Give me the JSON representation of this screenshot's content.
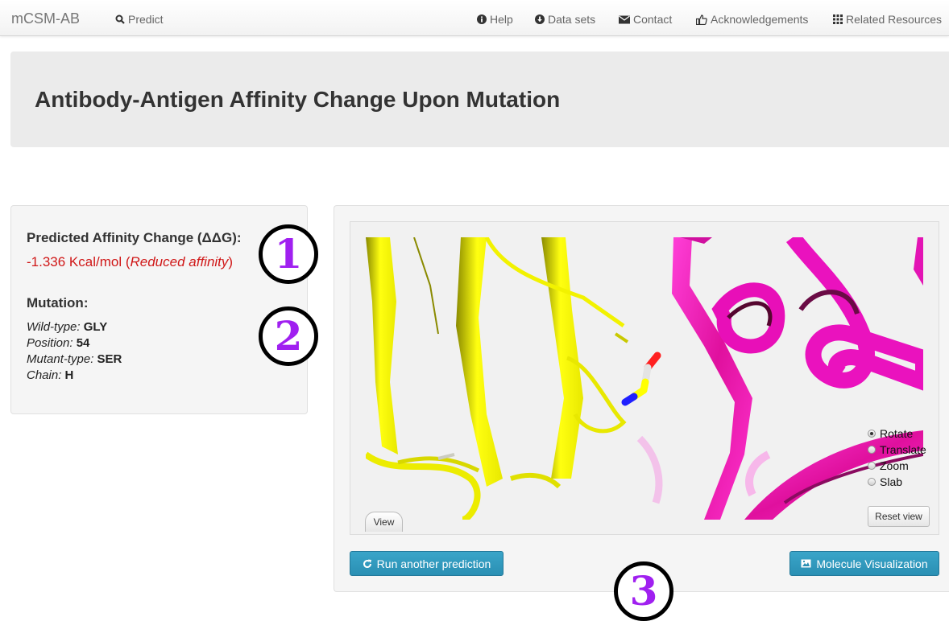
{
  "nav": {
    "brand": "mCSM-AB",
    "predict": "Predict",
    "help": "Help",
    "datasets": "Data sets",
    "contact": "Contact",
    "acknowledgements": "Acknowledgements",
    "related": "Related Resources"
  },
  "header": {
    "title": "Antibody-Antigen Affinity Change Upon Mutation"
  },
  "result": {
    "ddg_heading": "Predicted Affinity Change (ΔΔG):",
    "ddg_value": "-1.336 Kcal/mol (",
    "ddg_effect": "Reduced affinity",
    "ddg_close": ")",
    "mutation_heading": "Mutation:",
    "wildtype_label": "Wild-type:",
    "wildtype_value": "GLY",
    "position_label": "Position:",
    "position_value": "54",
    "mutant_label": "Mutant-type:",
    "mutant_value": "SER",
    "chain_label": "Chain:",
    "chain_value": "H"
  },
  "annotations": {
    "one": "1",
    "two": "2",
    "three": "3"
  },
  "viewer": {
    "modes": [
      "Rotate",
      "Translate",
      "Zoom",
      "Slab"
    ],
    "selected_mode": "Rotate",
    "view_button": "View",
    "reset_button": "Reset view"
  },
  "actions": {
    "run_again": "Run another prediction",
    "molecule_vis": "Molecule Visualization"
  },
  "colors": {
    "ddg_text": "#d01818",
    "annotation_digit": "#a020f0",
    "primary_button": "#2a8fb3",
    "antibody_ribbon": "#ffff00",
    "antigen_ribbon": "#ff1acb"
  }
}
